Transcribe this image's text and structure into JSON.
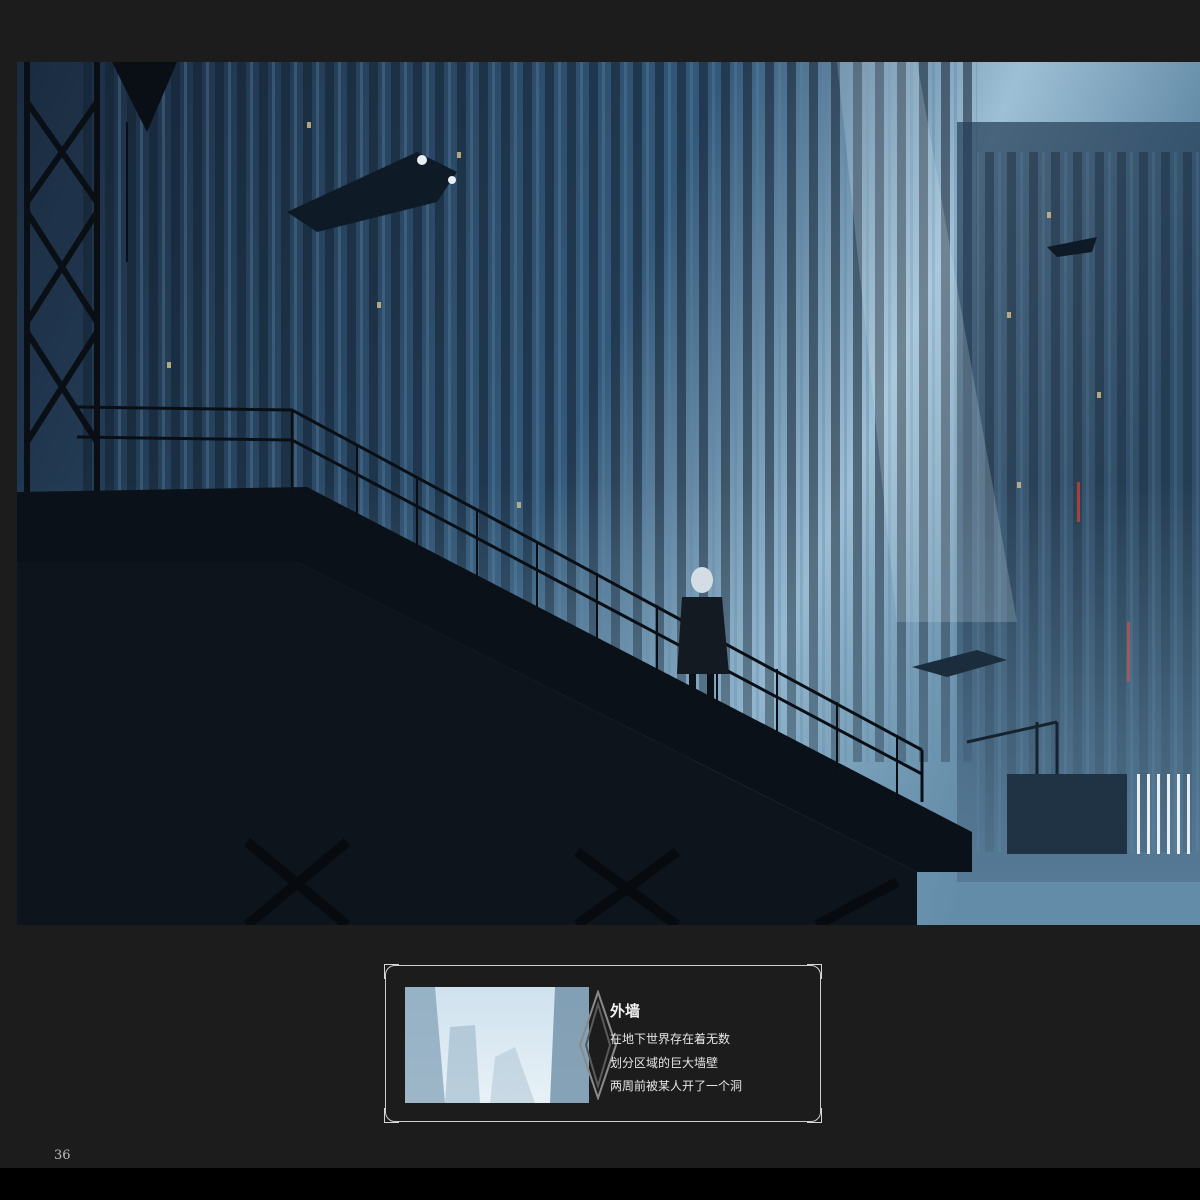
{
  "caption": {
    "title": "外墙",
    "lines": [
      "在地下世界存在着无数",
      "划分区域的巨大墙壁",
      "两周前被某人开了一个洞"
    ]
  },
  "page_number": "36"
}
